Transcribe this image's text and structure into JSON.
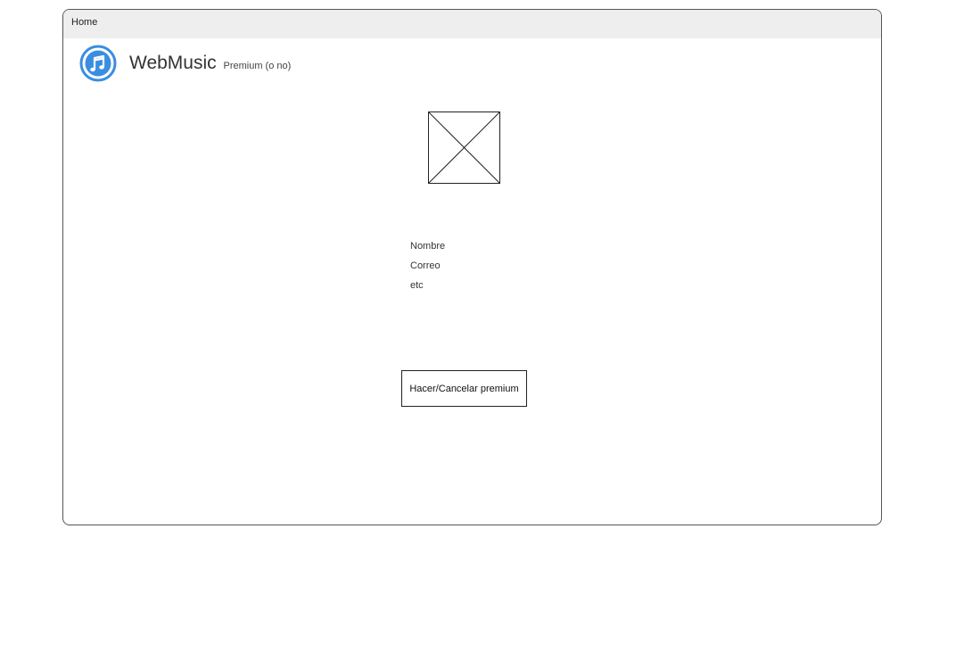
{
  "tabbar": {
    "home_label": "Home"
  },
  "header": {
    "logo_icon": "music-note-icon",
    "title": "WebMusic",
    "premium_status": "Premium (o no)"
  },
  "profile": {
    "avatar_icon": "image-placeholder-icon",
    "fields": [
      "Nombre",
      "Correo",
      "etc"
    ]
  },
  "actions": {
    "premium_toggle_label": "Hacer/Cancelar premium"
  },
  "colors": {
    "accent": "#3a8ee0",
    "tabbar_bg": "#eeeeee",
    "border": "#555555"
  }
}
